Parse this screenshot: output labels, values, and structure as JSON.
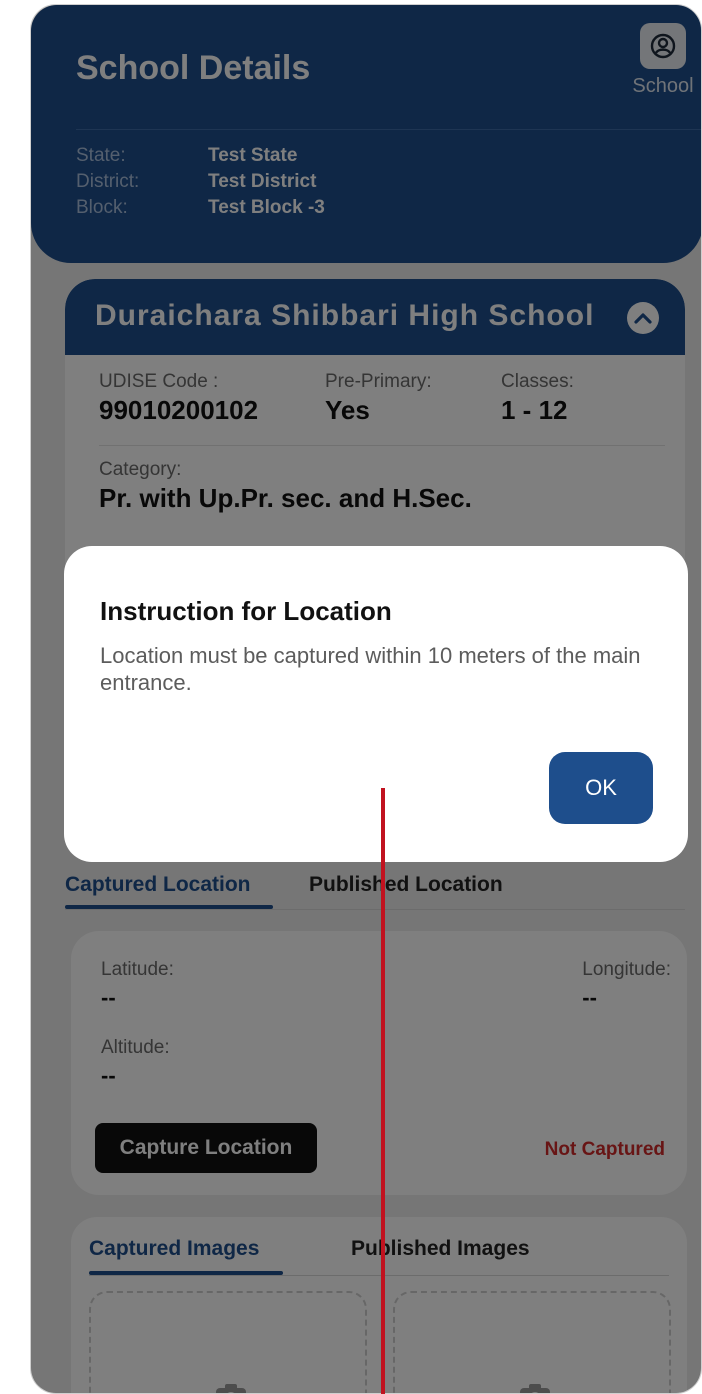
{
  "header": {
    "title": "School Details",
    "school_button_label": "School",
    "meta": [
      {
        "key": "State:",
        "value": "Test State"
      },
      {
        "key": "District:",
        "value": "Test District"
      },
      {
        "key": "Block:",
        "value": "Test Block -3"
      }
    ]
  },
  "school_card": {
    "name": "Duraichara Shibbari High School",
    "udise": {
      "label": "UDISE Code :",
      "value": "99010200102"
    },
    "pre_primary": {
      "label": "Pre-Primary:",
      "value": "Yes"
    },
    "classes": {
      "label": "Classes:",
      "value": "1 - 12"
    },
    "category": {
      "label": "Category:",
      "value": "Pr. with Up.Pr. sec. and H.Sec."
    }
  },
  "location_tabs": {
    "captured": "Captured Location",
    "published": "Published Location"
  },
  "location": {
    "latitude_label": "Latitude:",
    "latitude_value": "--",
    "longitude_label": "Longitude:",
    "longitude_value": "--",
    "altitude_label": "Altitude:",
    "altitude_value": "--",
    "capture_button": "Capture Location",
    "status": "Not Captured"
  },
  "image_tabs": {
    "captured": "Captured Images",
    "published": "Published Images"
  },
  "dialog": {
    "title": "Instruction for Location",
    "message": "Location must be captured within 10 meters of the main entrance.",
    "ok_button": "OK"
  },
  "colors": {
    "primary": "#1e4e8c",
    "status_red": "#d12a2a",
    "annotation_red": "#c1121f"
  }
}
